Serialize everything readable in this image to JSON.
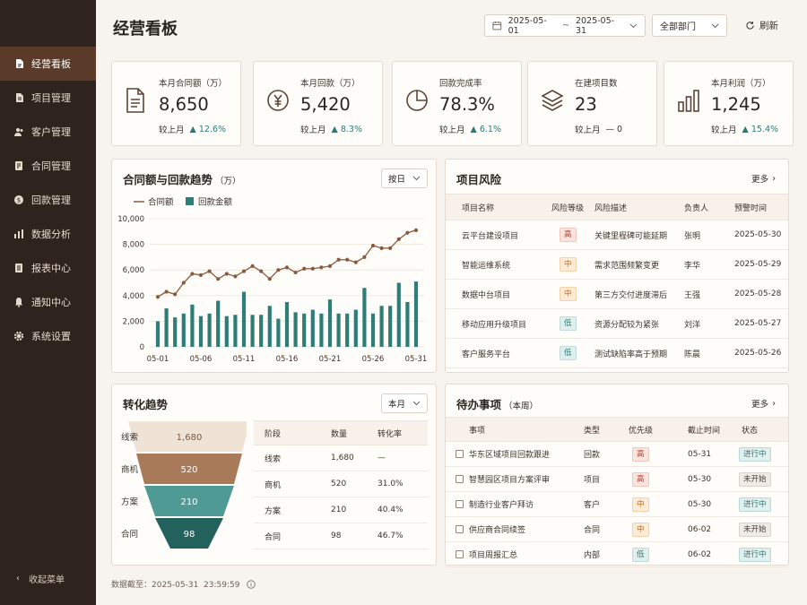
{
  "sidebar": {
    "items": [
      {
        "label": "经营看板",
        "icon": "dashboard-doc-icon",
        "active": true
      },
      {
        "label": "项目管理",
        "icon": "project-doc-icon"
      },
      {
        "label": "客户管理",
        "icon": "users-icon"
      },
      {
        "label": "合同管理",
        "icon": "contract-icon"
      },
      {
        "label": "回款管理",
        "icon": "payment-icon"
      },
      {
        "label": "数据分析",
        "icon": "bar-chart-icon"
      },
      {
        "label": "报表中心",
        "icon": "report-icon"
      },
      {
        "label": "通知中心",
        "icon": "bell-icon"
      },
      {
        "label": "系统设置",
        "icon": "gear-icon"
      }
    ],
    "collapse_label": "收起菜单"
  },
  "header": {
    "title": "经营看板",
    "date_start": "2025-05-01",
    "date_sep": "~",
    "date_end": "2025-05-31",
    "dept": "全部部门",
    "refresh": "刷新"
  },
  "kpis": [
    {
      "label": "本月合同额（万）",
      "value": "8,650",
      "compare_label": "较上月",
      "trend": "▲ 12.6%",
      "icon": "document-icon"
    },
    {
      "label": "本月回款（万）",
      "value": "5,420",
      "compare_label": "较上月",
      "trend": "▲ 8.3%",
      "icon": "yen-icon"
    },
    {
      "label": "回款完成率",
      "value": "78.3%",
      "compare_label": "较上月",
      "trend": "▲ 6.1%",
      "icon": "pie-icon"
    },
    {
      "label": "在建项目数",
      "value": "23",
      "compare_label": "较上月",
      "trend": "— 0",
      "icon": "layers-icon"
    },
    {
      "label": "本月利润（万）",
      "value": "1,245",
      "compare_label": "较上月",
      "trend": "▲ 15.4%",
      "icon": "bar-chart-icon"
    }
  ],
  "trend_panel": {
    "title": "合同额与回款趋势",
    "unit": "（万）",
    "period": "按日"
  },
  "chart_data": {
    "type": "bar",
    "title": "合同额与回款趋势（万）",
    "x": [
      "05-01",
      "05-02",
      "05-03",
      "05-04",
      "05-05",
      "05-06",
      "05-07",
      "05-08",
      "05-09",
      "05-10",
      "05-11",
      "05-12",
      "05-13",
      "05-14",
      "05-15",
      "05-16",
      "05-17",
      "05-18",
      "05-19",
      "05-20",
      "05-21",
      "05-22",
      "05-23",
      "05-24",
      "05-25",
      "05-26",
      "05-27",
      "05-28",
      "05-29",
      "05-30",
      "05-31"
    ],
    "x_ticks": [
      "05-01",
      "05-06",
      "05-11",
      "05-16",
      "05-21",
      "05-26",
      "05-31"
    ],
    "y_ticks": [
      "0",
      "2,000",
      "4,000",
      "6,000",
      "8,000",
      "10,000"
    ],
    "ylim": [
      0,
      10000
    ],
    "series": [
      {
        "name": "合同额",
        "type": "line",
        "color": "#8a5a3c",
        "values": [
          3900,
          4300,
          4100,
          5000,
          5700,
          5600,
          5900,
          5300,
          5700,
          5500,
          5900,
          6300,
          5900,
          5300,
          6000,
          6200,
          5800,
          6100,
          6100,
          6200,
          6300,
          6800,
          6800,
          6600,
          7000,
          7900,
          7700,
          7700,
          8400,
          8900,
          9100
        ]
      },
      {
        "name": "回款金额",
        "type": "bar",
        "color": "#2f7d77",
        "values": [
          2000,
          3000,
          2300,
          2600,
          3300,
          2400,
          2600,
          3600,
          2400,
          2500,
          4300,
          2500,
          2500,
          3200,
          2200,
          3500,
          2700,
          2600,
          2900,
          2600,
          3700,
          2600,
          2600,
          2900,
          4600,
          2600,
          3200,
          3200,
          5000,
          3500,
          5100
        ]
      }
    ]
  },
  "risk_panel": {
    "title": "项目风险",
    "more": "更多",
    "columns": [
      "项目名称",
      "风险等级",
      "风险描述",
      "负责人",
      "预警时间"
    ],
    "rows": [
      {
        "name": "云平台建设项目",
        "level": "高",
        "level_class": "high",
        "desc": "关键里程碑可能延期",
        "owner": "张明",
        "date": "2025-05-30"
      },
      {
        "name": "智能运维系统",
        "level": "中",
        "level_class": "mid",
        "desc": "需求范围频繁变更",
        "owner": "李华",
        "date": "2025-05-29"
      },
      {
        "name": "数据中台项目",
        "level": "中",
        "level_class": "mid",
        "desc": "第三方交付进度滞后",
        "owner": "王强",
        "date": "2025-05-28"
      },
      {
        "name": "移动应用升级项目",
        "level": "低",
        "level_class": "low",
        "desc": "资源分配较为紧张",
        "owner": "刘洋",
        "date": "2025-05-27"
      },
      {
        "name": "客户服务平台",
        "level": "低",
        "level_class": "low",
        "desc": "测试缺陷率高于预期",
        "owner": "陈晨",
        "date": "2025-05-26"
      }
    ]
  },
  "funnel_panel": {
    "title": "转化趋势",
    "period": "本月",
    "stages": [
      {
        "label": "线索",
        "count": "1,680",
        "rate": "—",
        "color": "#efe3d5",
        "text_color": "#7a5a42"
      },
      {
        "label": "商机",
        "count": "520",
        "rate": "31.0%",
        "color": "#a97a5a",
        "text_color": "#ffffff"
      },
      {
        "label": "方案",
        "count": "210",
        "rate": "40.4%",
        "color": "#4f9a94",
        "text_color": "#ffffff"
      },
      {
        "label": "合同",
        "count": "98",
        "rate": "46.7%",
        "color": "#22615c",
        "text_color": "#ffffff"
      }
    ],
    "columns": [
      "阶段",
      "数量",
      "转化率"
    ]
  },
  "todo_panel": {
    "title": "待办事项",
    "subtitle": "（本周）",
    "more": "更多",
    "columns": [
      "事项",
      "类型",
      "优先级",
      "截止时间",
      "状态"
    ],
    "rows": [
      {
        "item": "华东区域项目回款跟进",
        "type": "回款",
        "priority": "高",
        "priority_class": "high",
        "due": "05-31",
        "status": "进行中",
        "status_class": "doing"
      },
      {
        "item": "智慧园区项目方案评审",
        "type": "项目",
        "priority": "高",
        "priority_class": "high",
        "due": "05-30",
        "status": "未开始",
        "status_class": "todo"
      },
      {
        "item": "制造行业客户拜访",
        "type": "客户",
        "priority": "中",
        "priority_class": "mid",
        "due": "05-30",
        "status": "进行中",
        "status_class": "doing"
      },
      {
        "item": "供应商合同续签",
        "type": "合同",
        "priority": "中",
        "priority_class": "mid",
        "due": "06-02",
        "status": "未开始",
        "status_class": "todo"
      },
      {
        "item": "项目周报汇总",
        "type": "内部",
        "priority": "低",
        "priority_class": "low",
        "due": "06-02",
        "status": "进行中",
        "status_class": "doing"
      }
    ]
  },
  "footer": {
    "label": "数据截至：",
    "datetime": "2025-05-31  23:59:59"
  }
}
